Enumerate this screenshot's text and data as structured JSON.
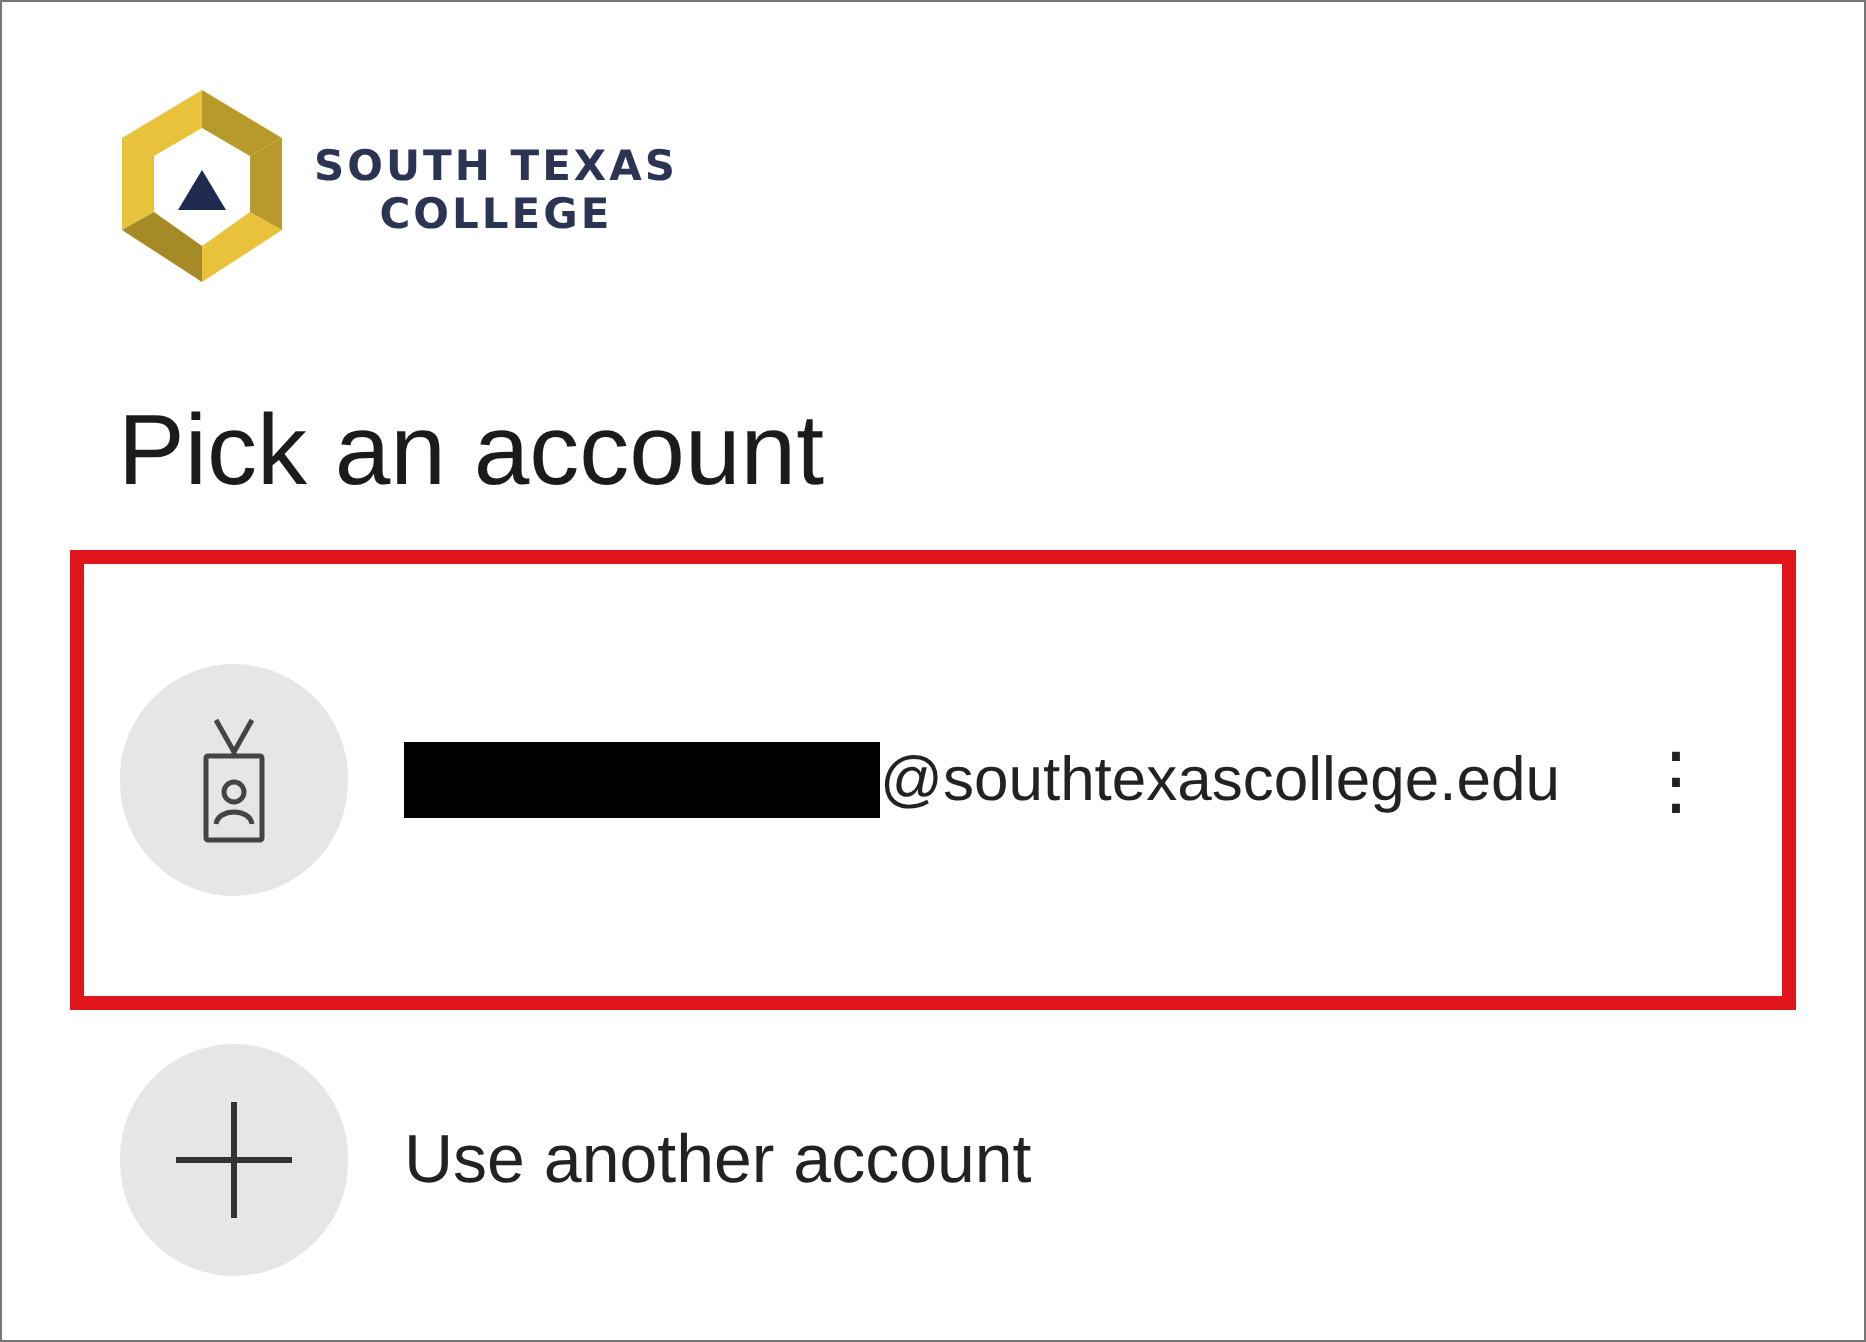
{
  "logo": {
    "lines": [
      "SOUTH TEXAS",
      "COLLEGE"
    ]
  },
  "heading": "Pick an account",
  "accounts": [
    {
      "kind": "account",
      "email": "@southtexascollege.edu",
      "redacted": true,
      "highlighted": true,
      "menu": "⋮"
    },
    {
      "kind": "add",
      "label": "Use another account",
      "highlighted": false
    }
  ]
}
